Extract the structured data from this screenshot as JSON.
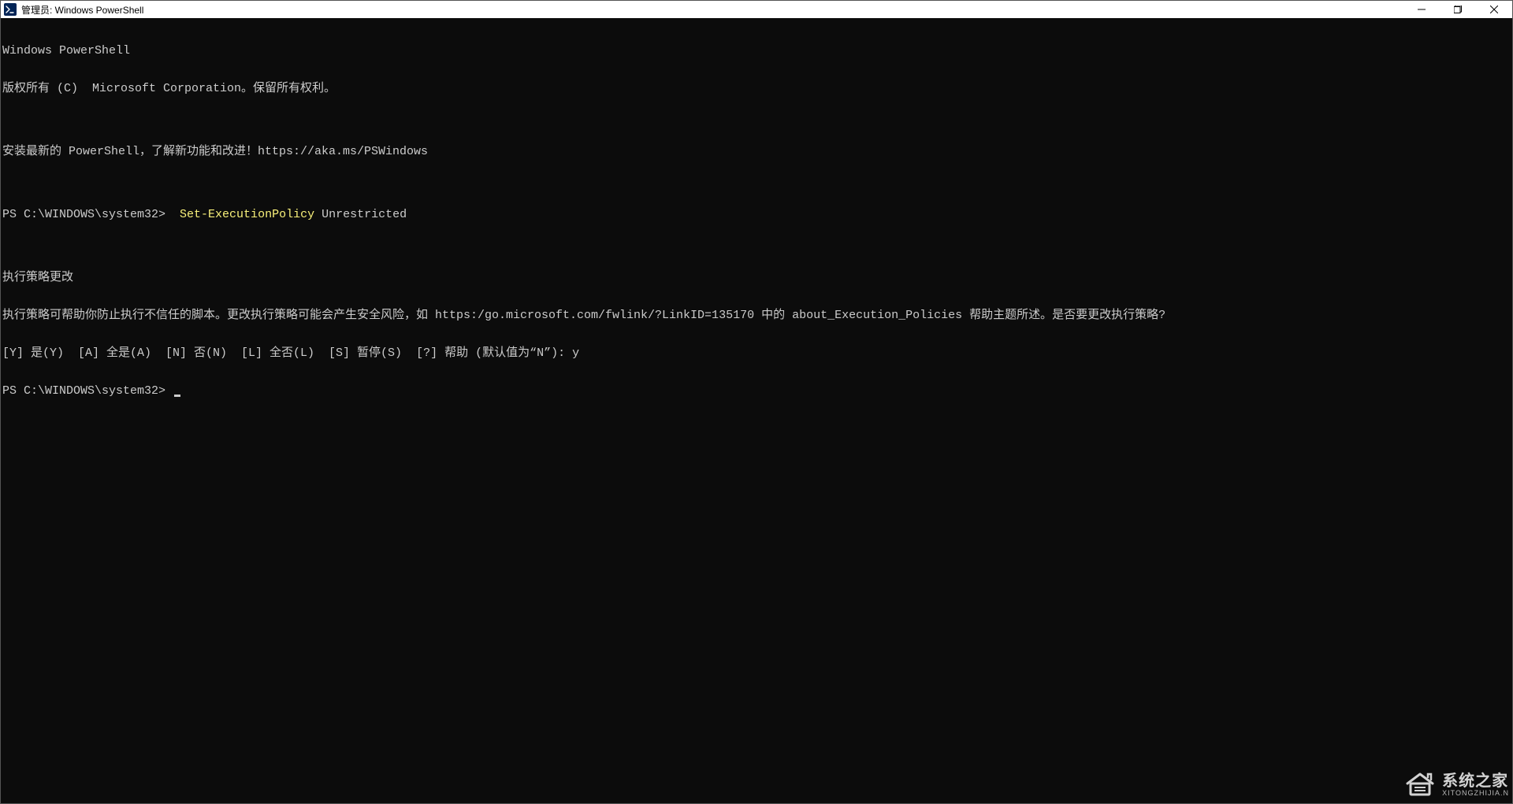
{
  "titlebar": {
    "title": "管理员: Windows PowerShell"
  },
  "terminal": {
    "header1": "Windows PowerShell",
    "header2": "版权所有 (C)  Microsoft Corporation。保留所有权利。",
    "blank": "",
    "install_tip": "安装最新的 PowerShell，了解新功能和改进！https://aka.ms/PSWindows",
    "prompt1_prefix": "PS C:\\WINDOWS\\system32>  ",
    "prompt1_cmd": "Set-ExecutionPolicy",
    "prompt1_arg": " Unrestricted",
    "policy_title": "执行策略更改",
    "policy_body": "执行策略可帮助你防止执行不信任的脚本。更改执行策略可能会产生安全风险，如 https:/go.microsoft.com/fwlink/?LinkID=135170 中的 about_Execution_Policies 帮助主题所述。是否要更改执行策略?",
    "policy_options": "[Y] 是(Y)  [A] 全是(A)  [N] 否(N)  [L] 全否(L)  [S] 暂停(S)  [?] 帮助 (默认值为“N”): y",
    "prompt2": "PS C:\\WINDOWS\\system32> "
  },
  "watermark": {
    "top": "系统之家",
    "bottom": "XITONGZHIJIA.N"
  }
}
